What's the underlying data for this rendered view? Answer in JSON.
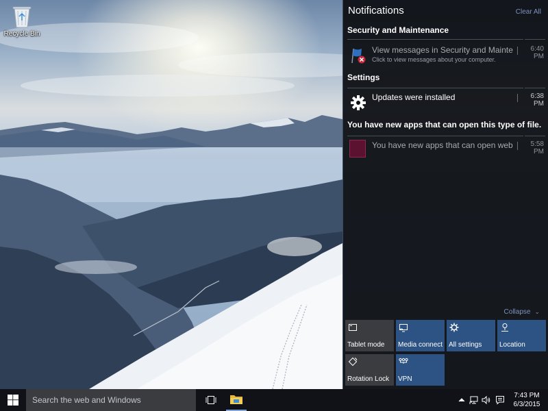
{
  "desktop": {
    "icons": [
      {
        "label": "Recycle Bin",
        "icon": "recycle-bin-icon"
      }
    ]
  },
  "action_center": {
    "title": "Notifications",
    "clear_all_label": "Clear All",
    "groups": [
      {
        "title": "Security and Maintenance",
        "notifications": [
          {
            "icon": "security-flag-icon",
            "title": "View messages in Security and Maintena",
            "subtitle": "Click to view messages about your computer.",
            "time": "6:40 PM"
          }
        ]
      },
      {
        "title": "Settings",
        "notifications": [
          {
            "icon": "gear-icon",
            "title": "Updates were installed",
            "time": "6:38 PM"
          }
        ]
      },
      {
        "title": "You have new apps that can open this type of file.",
        "notifications": [
          {
            "icon": "app-tile-icon",
            "title": "You have new apps that can open webp:",
            "time": "5:58 PM"
          }
        ]
      }
    ],
    "collapse_label": "Collapse",
    "quick_actions": [
      {
        "label": "Tablet mode",
        "icon": "tablet-mode-icon",
        "state": "off"
      },
      {
        "label": "Media connect",
        "icon": "media-connect-icon",
        "state": "on"
      },
      {
        "label": "All settings",
        "icon": "gear-icon",
        "state": "on"
      },
      {
        "label": "Location",
        "icon": "location-icon",
        "state": "on"
      },
      {
        "label": "Rotation Lock",
        "icon": "rotation-lock-icon",
        "state": "off"
      },
      {
        "label": "VPN",
        "icon": "vpn-icon",
        "state": "on"
      }
    ],
    "colors": {
      "panel_bg": "#0e1014",
      "tile_active": "#2d5384",
      "tile_inactive": "#3a3c3f",
      "link": "#7c94c0",
      "app_tile": "#5a1230"
    }
  },
  "taskbar": {
    "start_icon": "windows-logo-icon",
    "search_placeholder": "Search the web and Windows",
    "task_view_icon": "task-view-icon",
    "pinned_apps": [
      {
        "name": "File Explorer",
        "icon": "folder-icon"
      }
    ],
    "tray_icons": [
      "chevron-up-icon",
      "network-icon",
      "volume-icon",
      "action-center-icon"
    ],
    "time": "7:43 PM",
    "date": "6/3/2015"
  }
}
